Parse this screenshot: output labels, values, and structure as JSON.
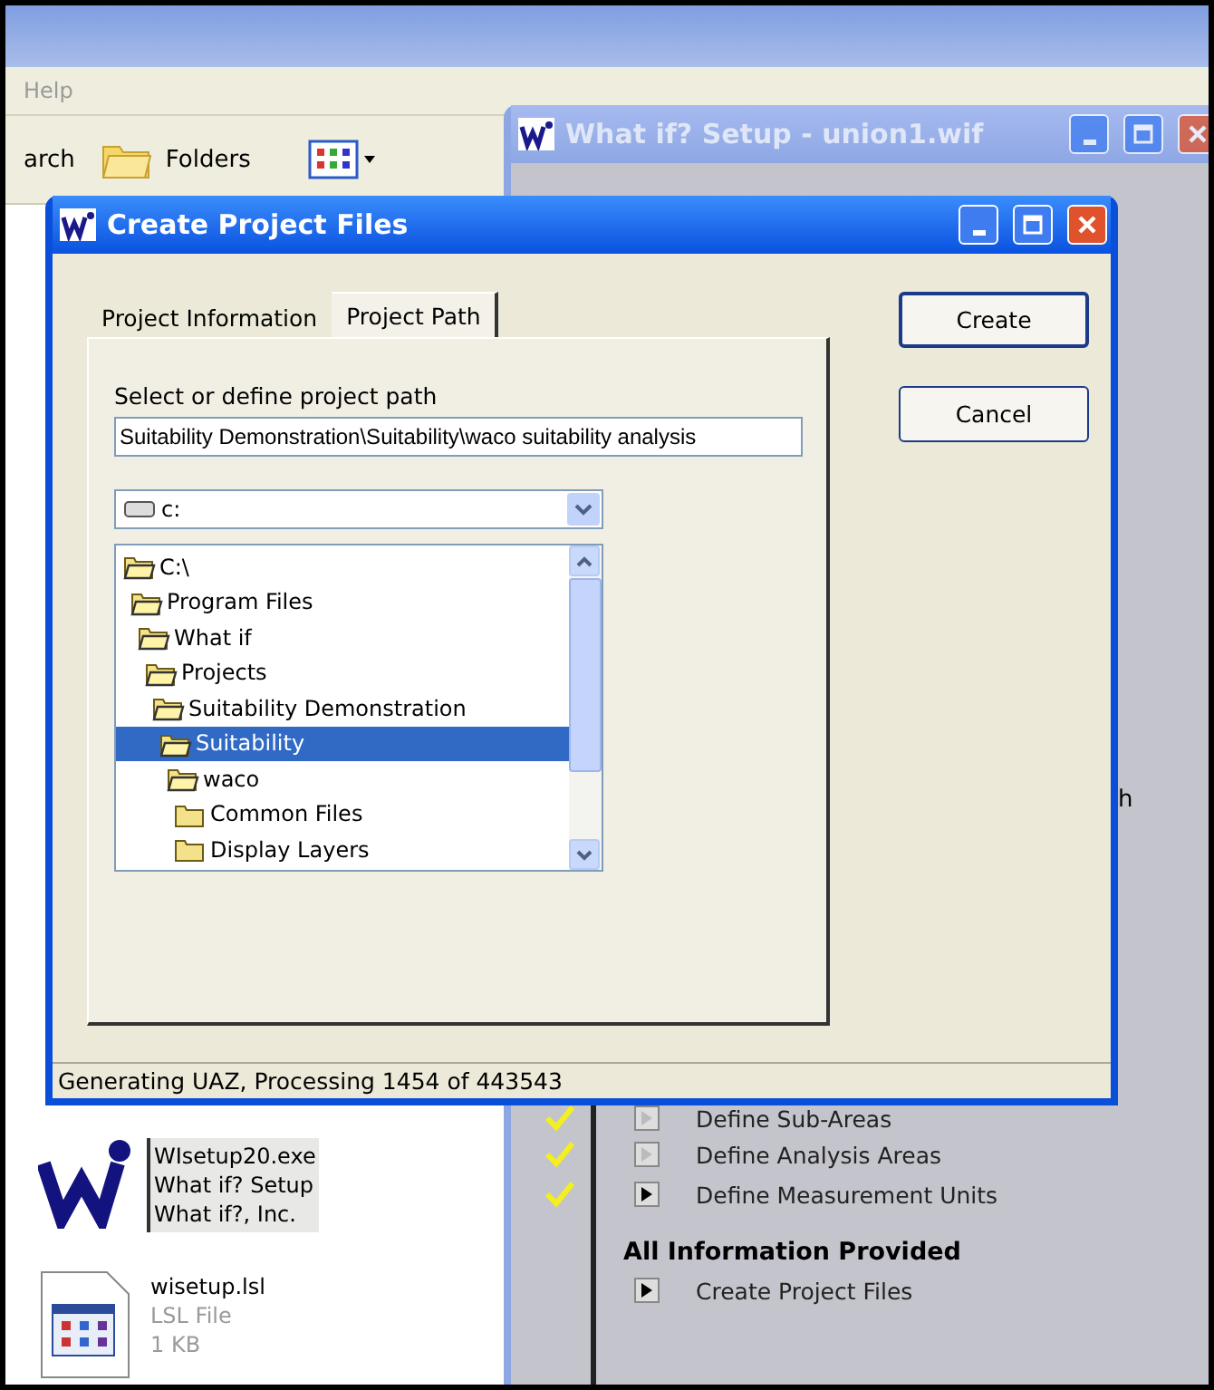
{
  "explorer": {
    "menu": [
      "Help"
    ],
    "toolbar": [
      {
        "kind": "text",
        "label": "arch"
      },
      {
        "kind": "folders",
        "label": "Folders"
      },
      {
        "kind": "views"
      }
    ],
    "files": [
      {
        "kind": "exe",
        "selected": true,
        "lines": [
          "WIsetup20.exe",
          "What if? Setup",
          "What if?, Inc."
        ]
      },
      {
        "kind": "doc",
        "selected": false,
        "lines": [
          "wisetup.lsl",
          "LSL File",
          "1 KB"
        ]
      }
    ]
  },
  "setup_window": {
    "title": "What if? Setup - union1.wif",
    "active": false,
    "fragment": "h",
    "steps": [
      {
        "label": "Define Sub-Areas",
        "done": true,
        "disabled": true
      },
      {
        "label": "Define Analysis Areas",
        "done": true,
        "disabled": true
      },
      {
        "label": "Define Measurement Units",
        "done": true,
        "disabled": false
      }
    ],
    "section": "All Information Provided",
    "final_step": {
      "label": "Create Project Files",
      "disabled": false
    }
  },
  "dialog": {
    "title": "Create Project Files",
    "active": true,
    "tabs": [
      {
        "label": "Project Information",
        "selected": false
      },
      {
        "label": "Project Path",
        "selected": true
      }
    ],
    "path_label": "Select or define project path",
    "path_value": "Suitability Demonstration\\Suitability\\waco suitability analysis",
    "drive": "c:",
    "tree": [
      {
        "label": "C:\\",
        "open": true,
        "selected": false,
        "children": [
          {
            "label": "Program Files",
            "open": true,
            "selected": false,
            "children": [
              {
                "label": "What if",
                "open": true,
                "selected": false,
                "children": [
                  {
                    "label": "Projects",
                    "open": true,
                    "selected": false,
                    "children": [
                      {
                        "label": "Suitability Demonstration",
                        "open": true,
                        "selected": false,
                        "children": [
                          {
                            "label": "Suitability",
                            "open": true,
                            "selected": true,
                            "children": [
                              {
                                "label": "waco",
                                "open": true,
                                "selected": false,
                                "children": [
                                  {
                                    "label": "Common Files",
                                    "open": false,
                                    "selected": false
                                  },
                                  {
                                    "label": "Display Layers",
                                    "open": false,
                                    "selected": false
                                  }
                                ]
                              }
                            ]
                          }
                        ]
                      }
                    ]
                  }
                ]
              }
            ]
          }
        ]
      }
    ],
    "buttons": [
      "Create",
      "Cancel"
    ],
    "status": "Generating UAZ, Processing 1454 of 443543"
  }
}
